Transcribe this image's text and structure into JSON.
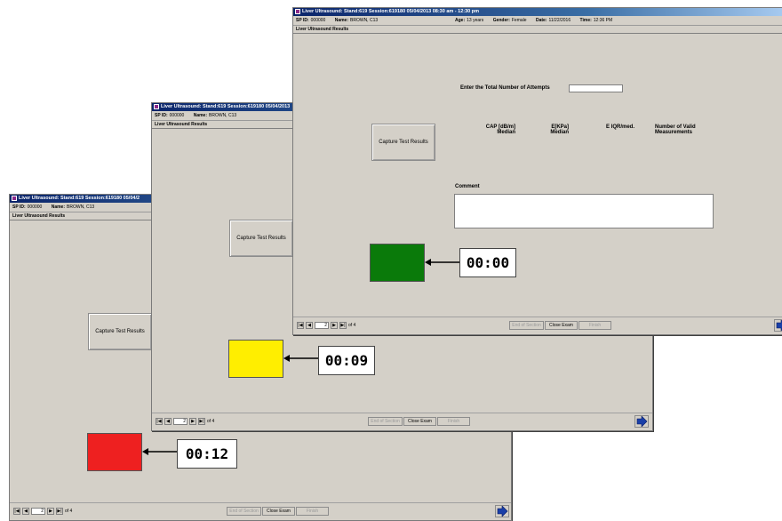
{
  "window_title": "Liver Ultrasound: Stand:619 Session:619180 05/04/2013 08:30 am - 12:30 pm",
  "window_title_short": "Liver Ultrasound: Stand:619 Session:619180 05/04/2",
  "window_title_mid": "Liver Ultrasound: Stand:619 Session:619180 05/04/2013",
  "info": {
    "sp_id_label": "SP ID:",
    "sp_id_value": "000000",
    "name_label": "Name:",
    "name_value": "BROWN, C13",
    "age_label": "Age:",
    "age_value": "13 years",
    "gender_label": "Gender:",
    "gender_value": "Female",
    "date_label": "Date:",
    "date_value": "11/22/2016",
    "time_label": "Time:",
    "time_value": "12:36 PM"
  },
  "section_title": "Liver Ultrasound Results",
  "capture_button": "Capture Test Results",
  "attempts_label": "Enter the Total Number of Attempts",
  "attempts_value": "",
  "columns": [
    {
      "line1": "CAP [dB/m]",
      "line2": "Median"
    },
    {
      "line1": "E[KPa]",
      "line2": "Median"
    },
    {
      "line1": "E IQR/med.",
      "line2": ""
    },
    {
      "line1": "Number of Valid",
      "line2": "Measurements"
    }
  ],
  "comment_label": "Comment",
  "comment_value": "",
  "nav": {
    "first": "|◀",
    "prev": "◀",
    "page": "2",
    "next": "▶",
    "last": "▶|",
    "of_pages": "of 4"
  },
  "buttons": {
    "end_of_section": "End of Section",
    "close_exam": "Close Exam",
    "finish": "Finish"
  },
  "timers": {
    "front": {
      "value": "00:00",
      "color": "#0a7a0a"
    },
    "middle": {
      "value": "00:09",
      "color": "#ffee00"
    },
    "back": {
      "value": "00:12",
      "color": "#ee2020"
    }
  }
}
